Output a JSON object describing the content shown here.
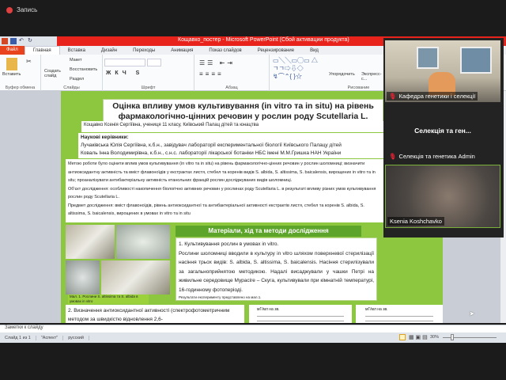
{
  "recording": {
    "label": "Запись"
  },
  "window": {
    "title": "Кощавко_постер  -  Microsoft PowerPoint (Сбой активации продукта)"
  },
  "tabs": [
    "Файл",
    "Главная",
    "Вставка",
    "Дизайн",
    "Переходы",
    "Анимация",
    "Показ слайдов",
    "Рецензирование",
    "Вид"
  ],
  "ribbon": {
    "clipboard": {
      "paste": "Вставить",
      "label": "Буфер обмена"
    },
    "slides": {
      "new": "Создать слайд",
      "layout": "Макет",
      "reset": "Восстановить",
      "section": "Раздел",
      "label": "Слайды"
    },
    "font": {
      "label": "Шрифт"
    },
    "paragraph": {
      "label": "Абзац"
    },
    "drawing": {
      "arrange": "Упорядочить",
      "quick": "Экспресс-с...",
      "label": "Рисование"
    }
  },
  "slide": {
    "title": "Оцінка впливу умов культивування (in vitro та in situ) на рівень фармакологічно-цінних речовин у рослин роду Scutellaria L.",
    "author": "Кощавко Ксенія Сергіївна, учениця 11 класу, Київський Палац дітей та юнацтва",
    "supervisors_head": "Наукові керівники:",
    "sup1": "Лучаківська Юлія Сергіївна, к.б.н., завідувач лабораторії експериментальної біології Київського Палацу дітей",
    "sup2": "Коваль Інна Володимирівна, к.б.н., с.н.с. лабораторії лікарської ботаніки НБС імені М.М.Гришка НАН України",
    "goal": "Метою роботи було оцінити вплив умов культивування (in vitro та in situ) на рівень фармакологічно-цінних речовин у рослин шоломниці; визначити антиоксидантну активність та вміст флавоноїдів у екстрактах листя, стебел та коренів видів S. albida, S. altissima, S. baicalensis, вирощених in vitro та in situ; проаналізувати антибактеріальну активність етанольних фракцій рослин досліджуваних видів шоломниці.",
    "object": "Об'єкт дослідження: особливості накопичення біологічно активних речовин у рослинах роду Scutellaria L. в результаті впливу різних умов культивування рослин роду Scutellaria L.",
    "subject": "Предмет дослідження: вміст флавоноїдів, рівень антиоксидантної та антибактеріальної активності екстрактів листя, стебел та коренів S. albida, S. altissima, S. baicalensis, вирощених в умовах in vitro та in situ",
    "caption": "Мал. 1. Рослини S. altissima та S. albida в умовах in vitro",
    "methods_header": "Матеріали, хід та методи дослідження",
    "m1_title": "1. Культивування рослин в умовах in vitro.",
    "m1_text": "Рослини шоломниці вводили в культуру in vitro шляхом поверхневої стерилізації насіння трьох видів: S. albida, S. altissima, S. baicalensis. Насіння стерилізували за загальноприйнятою методикою. Надалі висаджували у чашки Петрі на живильне середовище Мурасіге – Скуга, культивували при кімнатній температурі, 16-годинному фотоперіоді.",
    "m1_result": "Результати експерименту представлено на мал.1.",
    "m2_text": "2. Визначення антиоксидантної активності (спектрофотометричним методом за швидкістю відновлення 2,6-",
    "chart1_title": "мГ/мл на зв.",
    "chart2_title": "мГ/мл на зв."
  },
  "notes": {
    "placeholder": "Заметки к слайду"
  },
  "status": {
    "slide": "Слайд 1 из 1",
    "theme": "\"Аспект\"",
    "lang": "русский",
    "zoom": "30%"
  },
  "gallery": {
    "p1": "Кафедра генетики і селекції",
    "p2_big": "Селекція та ген...",
    "p2": "Селекція та генетика Admin",
    "p3": "Ksenia Koshchavko"
  }
}
